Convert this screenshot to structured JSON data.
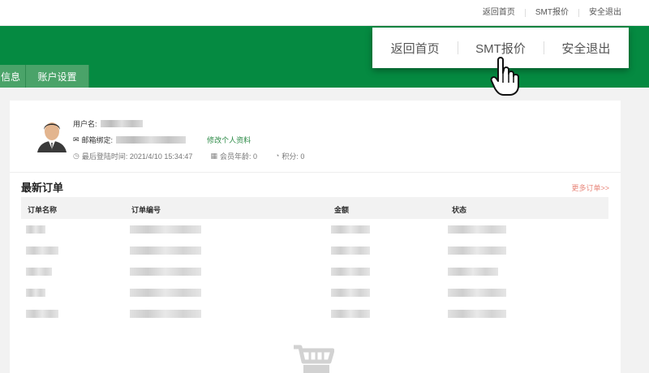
{
  "top_links": [
    "返回首页",
    "SMT报价",
    "安全退出"
  ],
  "tabs": [
    "信息",
    "账户设置"
  ],
  "popup_menu": [
    "返回首页",
    "SMT报价",
    "安全退出"
  ],
  "profile": {
    "username_label": "用户名:",
    "email_label": "邮箱绑定:",
    "edit_link": "修改个人资料",
    "last_login": "最后登陆时间: 2021/4/10 15:34:47",
    "member_age": "会员年龄: 0",
    "points": "积分: 0"
  },
  "orders": {
    "title": "最新订单",
    "more_link": "更多订单>>",
    "columns": [
      "订单名称",
      "订单编号",
      "金额",
      "状态"
    ]
  },
  "icons": {
    "email": "envelope-icon",
    "clock": "clock-icon",
    "calendar": "calendar-icon",
    "points": "gauge-icon",
    "cursor": "hand-pointer-icon",
    "empty": "shopping-cart-icon"
  },
  "colors": {
    "brand_green": "#058a41",
    "tab_green": "#4aa369",
    "link_green": "#2c8a46",
    "more_link": "#e8867a"
  }
}
